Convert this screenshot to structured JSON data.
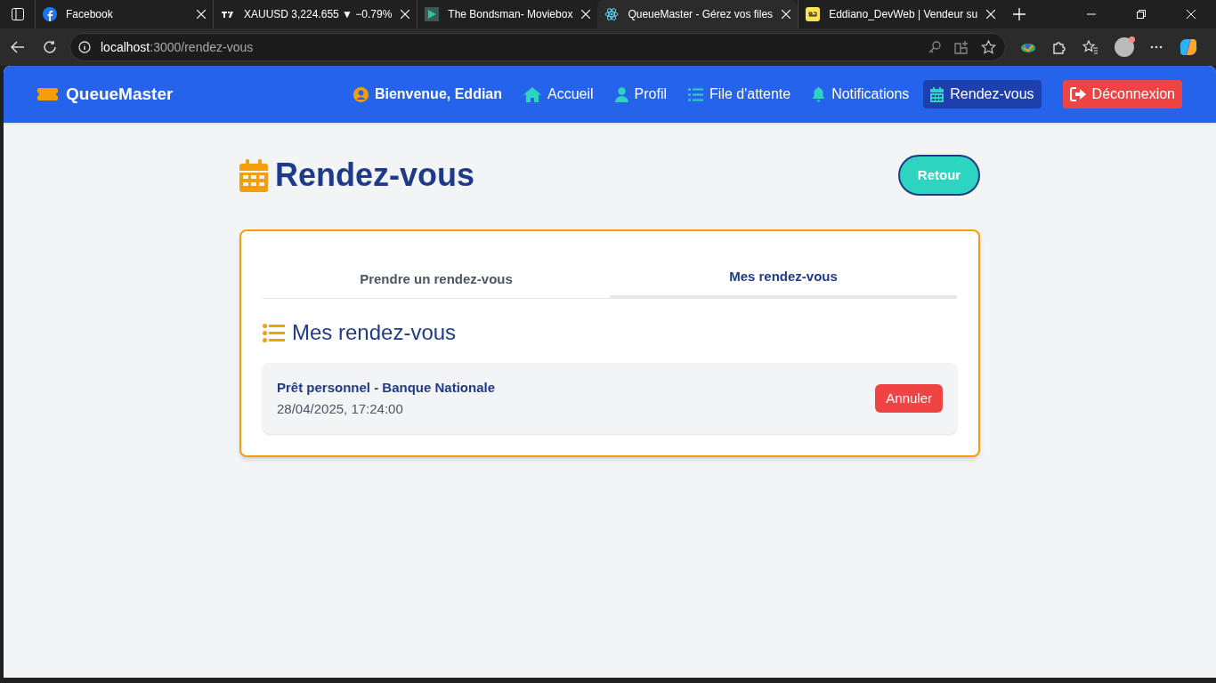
{
  "browser": {
    "tabs": [
      {
        "title": "Facebook",
        "selected": false
      },
      {
        "title": "XAUUSD 3,224.655 ▼ −0.79%",
        "selected": false
      },
      {
        "title": "The Bondsman- Moviebox",
        "selected": false
      },
      {
        "title": "QueueMaster - Gérez vos files",
        "selected": true
      },
      {
        "title": "Eddiano_DevWeb | Vendeur su",
        "selected": false
      }
    ],
    "address": "**localhost**:3000/rendez-vous"
  },
  "navbar": {
    "brand": "QueueMaster",
    "items": [
      {
        "kind": "greeting",
        "label": "Bienvenue, Eddian",
        "selected": false
      },
      {
        "kind": "link",
        "label": "Accueil",
        "selected": false
      },
      {
        "kind": "link",
        "label": "Profil",
        "selected": false
      },
      {
        "kind": "link",
        "label": "File d'attente",
        "selected": false
      },
      {
        "kind": "link",
        "label": "Notifications",
        "selected": false
      },
      {
        "kind": "link",
        "label": "Rendez-vous",
        "selected": true
      },
      {
        "kind": "logout",
        "label": "Déconnexion",
        "selected": false
      }
    ]
  },
  "page": {
    "title": "Rendez-vous",
    "back_button": "Retour",
    "tabs": [
      {
        "label": "Prendre un rendez-vous",
        "selected": false
      },
      {
        "label": "Mes rendez-vous",
        "selected": true
      }
    ],
    "section_title": "Mes rendez-vous",
    "appointments": [
      {
        "title": "Prêt personnel - Banque Nationale",
        "datetime": "28/04/2025, 17:24:00",
        "action": "Annuler"
      }
    ]
  }
}
